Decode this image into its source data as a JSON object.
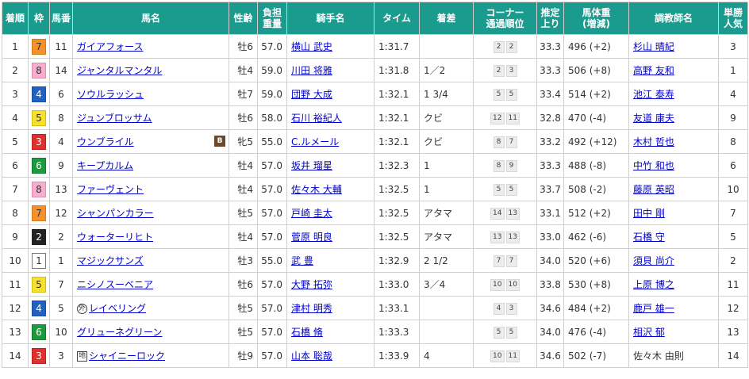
{
  "headers": {
    "rank": "着順",
    "waku": "枠",
    "umaban": "馬番",
    "horse": "馬名",
    "sexage": "性齢",
    "weight": "負担重量",
    "jockey": "騎手名",
    "time": "タイム",
    "margin": "着差",
    "corner": "コーナー通過順位",
    "last3f": "推定上り",
    "bodyweight": "馬体重(増減)",
    "trainer": "調教師名",
    "popularity": "単勝人気"
  },
  "rows": [
    {
      "rank": "1",
      "waku": "7",
      "umaban": "11",
      "horse": "ガイアフォース",
      "tag": "",
      "blinker": "",
      "sexage": "牡6",
      "weight": "57.0",
      "jockey": "横山 武史",
      "time": "1:31.7",
      "margin": "",
      "corner": [
        "2",
        "2"
      ],
      "last3f": "33.3",
      "bodyweight": "496 (+2)",
      "trainer": "杉山 晴紀",
      "trainer_link": true,
      "pop": "3"
    },
    {
      "rank": "2",
      "waku": "8",
      "umaban": "14",
      "horse": "ジャンタルマンタル",
      "tag": "",
      "blinker": "",
      "sexage": "牡4",
      "weight": "59.0",
      "jockey": "川田 将雅",
      "time": "1:31.8",
      "margin": "1／2",
      "corner": [
        "2",
        "3"
      ],
      "last3f": "33.3",
      "bodyweight": "506 (+8)",
      "trainer": "高野 友和",
      "trainer_link": true,
      "pop": "1"
    },
    {
      "rank": "3",
      "waku": "4",
      "umaban": "6",
      "horse": "ソウルラッシュ",
      "tag": "",
      "blinker": "",
      "sexage": "牡7",
      "weight": "59.0",
      "jockey": "団野 大成",
      "time": "1:32.1",
      "margin": "1 3/4",
      "corner": [
        "5",
        "5"
      ],
      "last3f": "33.4",
      "bodyweight": "514 (+2)",
      "trainer": "池江 泰寿",
      "trainer_link": true,
      "pop": "4"
    },
    {
      "rank": "4",
      "waku": "5",
      "umaban": "8",
      "horse": "ジュンブロッサム",
      "tag": "",
      "blinker": "",
      "sexage": "牡6",
      "weight": "58.0",
      "jockey": "石川 裕紀人",
      "time": "1:32.1",
      "margin": "クビ",
      "corner": [
        "12",
        "11"
      ],
      "last3f": "32.8",
      "bodyweight": "470 (-4)",
      "trainer": "友道 康夫",
      "trainer_link": true,
      "pop": "9"
    },
    {
      "rank": "5",
      "waku": "3",
      "umaban": "4",
      "horse": "ウンブライル",
      "tag": "",
      "blinker": "B",
      "sexage": "牝5",
      "weight": "55.0",
      "jockey": "C.ルメール",
      "time": "1:32.1",
      "margin": "クビ",
      "corner": [
        "8",
        "7"
      ],
      "last3f": "33.2",
      "bodyweight": "492 (+12)",
      "trainer": "木村 哲也",
      "trainer_link": true,
      "pop": "8"
    },
    {
      "rank": "6",
      "waku": "6",
      "umaban": "9",
      "horse": "キープカルム",
      "tag": "",
      "blinker": "",
      "sexage": "牡4",
      "weight": "57.0",
      "jockey": "坂井 瑠星",
      "time": "1:32.3",
      "margin": "1",
      "corner": [
        "8",
        "9"
      ],
      "last3f": "33.3",
      "bodyweight": "488 (-8)",
      "trainer": "中竹 和也",
      "trainer_link": true,
      "pop": "6"
    },
    {
      "rank": "7",
      "waku": "8",
      "umaban": "13",
      "horse": "ファーヴェント",
      "tag": "",
      "blinker": "",
      "sexage": "牡4",
      "weight": "57.0",
      "jockey": "佐々木 大輔",
      "time": "1:32.5",
      "margin": "1",
      "corner": [
        "5",
        "5"
      ],
      "last3f": "33.7",
      "bodyweight": "508 (-2)",
      "trainer": "藤原 英昭",
      "trainer_link": true,
      "pop": "10"
    },
    {
      "rank": "8",
      "waku": "7",
      "umaban": "12",
      "horse": "シャンパンカラー",
      "tag": "",
      "blinker": "",
      "sexage": "牡5",
      "weight": "57.0",
      "jockey": "戸崎 圭太",
      "time": "1:32.5",
      "margin": "アタマ",
      "corner": [
        "14",
        "13"
      ],
      "last3f": "33.1",
      "bodyweight": "512 (+2)",
      "trainer": "田中 剛",
      "trainer_link": true,
      "pop": "7"
    },
    {
      "rank": "9",
      "waku": "2",
      "umaban": "2",
      "horse": "ウォーターリヒト",
      "tag": "",
      "blinker": "",
      "sexage": "牡4",
      "weight": "57.0",
      "jockey": "菅原 明良",
      "time": "1:32.5",
      "margin": "アタマ",
      "corner": [
        "13",
        "13"
      ],
      "last3f": "33.0",
      "bodyweight": "462 (-6)",
      "trainer": "石橋 守",
      "trainer_link": true,
      "pop": "5"
    },
    {
      "rank": "10",
      "waku": "1",
      "umaban": "1",
      "horse": "マジックサンズ",
      "tag": "",
      "blinker": "",
      "sexage": "牡3",
      "weight": "55.0",
      "jockey": "武 豊",
      "time": "1:32.9",
      "margin": "2 1/2",
      "corner": [
        "7",
        "7"
      ],
      "last3f": "34.0",
      "bodyweight": "520 (+6)",
      "trainer": "須貝 尚介",
      "trainer_link": true,
      "pop": "2"
    },
    {
      "rank": "11",
      "waku": "5",
      "umaban": "7",
      "horse": "ニシノスーベニア",
      "tag": "",
      "blinker": "",
      "sexage": "牡6",
      "weight": "57.0",
      "jockey": "大野 拓弥",
      "time": "1:33.0",
      "margin": "3／4",
      "corner": [
        "10",
        "10"
      ],
      "last3f": "33.8",
      "bodyweight": "530 (+8)",
      "trainer": "上原 博之",
      "trainer_link": true,
      "pop": "11"
    },
    {
      "rank": "12",
      "waku": "4",
      "umaban": "5",
      "horse": "レイベリング",
      "tag": "外",
      "blinker": "",
      "sexage": "牡5",
      "weight": "57.0",
      "jockey": "津村 明秀",
      "time": "1:33.1",
      "margin": "",
      "corner": [
        "4",
        "3"
      ],
      "last3f": "34.6",
      "bodyweight": "484 (+2)",
      "trainer": "鹿戸 雄一",
      "trainer_link": true,
      "pop": "12"
    },
    {
      "rank": "13",
      "waku": "6",
      "umaban": "10",
      "horse": "グリューネグリーン",
      "tag": "",
      "blinker": "",
      "sexage": "牡5",
      "weight": "57.0",
      "jockey": "石橋 脩",
      "time": "1:33.3",
      "margin": "",
      "corner": [
        "5",
        "5"
      ],
      "last3f": "34.0",
      "bodyweight": "476 (-4)",
      "trainer": "相沢 郁",
      "trainer_link": true,
      "pop": "13"
    },
    {
      "rank": "14",
      "waku": "3",
      "umaban": "3",
      "horse": "シャイニーロック",
      "tag": "地",
      "blinker": "",
      "sexage": "牡9",
      "weight": "57.0",
      "jockey": "山本 聡哉",
      "time": "1:33.9",
      "margin": "4",
      "corner": [
        "10",
        "11"
      ],
      "last3f": "34.6",
      "bodyweight": "502 (-7)",
      "trainer": "佐々木 由則",
      "trainer_link": false,
      "pop": "14"
    }
  ]
}
